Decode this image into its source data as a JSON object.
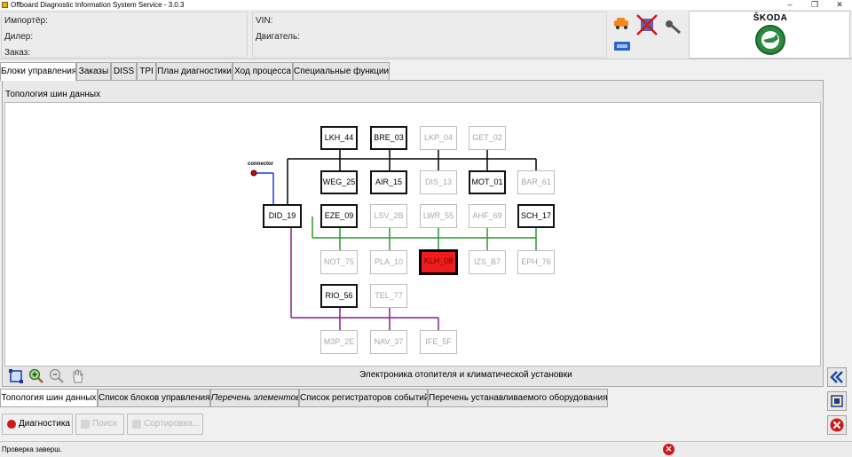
{
  "window": {
    "title": "Offboard Diagnostic Information System Service - 3.0.3",
    "minimize_glyph": "–",
    "restore_glyph": "❐",
    "close_glyph": "✕"
  },
  "header": {
    "importer_label": "Импортёр:",
    "dealer_label": "Дилер:",
    "order_label": "Заказ:",
    "vin_label": "VIN:",
    "engine_label": "Двигатель:",
    "brand": "ŠKODA"
  },
  "main_tabs": [
    {
      "label": "Блоки управления",
      "active": true
    },
    {
      "label": "Заказы"
    },
    {
      "label": "DISS"
    },
    {
      "label": "TPI"
    },
    {
      "label": "План диагностики"
    },
    {
      "label": "Ход процесса"
    },
    {
      "label": "Специальные функции"
    }
  ],
  "topology": {
    "title": "Топология шин данных",
    "connector_label": "connector",
    "description": "Электроника отопителя и климатической установки",
    "nodes": [
      {
        "id": "LKH_44",
        "state": "active"
      },
      {
        "id": "BRE_03",
        "state": "active"
      },
      {
        "id": "LKP_04",
        "state": "inactive"
      },
      {
        "id": "GET_02",
        "state": "inactive"
      },
      {
        "id": "WEG_25",
        "state": "active"
      },
      {
        "id": "AIR_15",
        "state": "active"
      },
      {
        "id": "DIS_13",
        "state": "inactive"
      },
      {
        "id": "MOT_01",
        "state": "active"
      },
      {
        "id": "BAR_61",
        "state": "inactive"
      },
      {
        "id": "DID_19",
        "state": "active"
      },
      {
        "id": "EZE_09",
        "state": "active"
      },
      {
        "id": "LSV_2B",
        "state": "inactive"
      },
      {
        "id": "LWR_55",
        "state": "inactive"
      },
      {
        "id": "AHF_69",
        "state": "inactive"
      },
      {
        "id": "SCH_17",
        "state": "active"
      },
      {
        "id": "NOT_75",
        "state": "inactive"
      },
      {
        "id": "PLA_10",
        "state": "inactive"
      },
      {
        "id": "KLH_08",
        "state": "selected"
      },
      {
        "id": "IZS_B7",
        "state": "inactive"
      },
      {
        "id": "EPH_76",
        "state": "inactive"
      },
      {
        "id": "RIO_56",
        "state": "active"
      },
      {
        "id": "TEL_77",
        "state": "inactive"
      },
      {
        "id": "M3P_2E",
        "state": "inactive"
      },
      {
        "id": "NAV_37",
        "state": "inactive"
      },
      {
        "id": "IFE_5F",
        "state": "inactive"
      }
    ],
    "bus_colors": {
      "diag": "#1e3fd0",
      "comfort": "#000000",
      "drive": "#2a9a2a",
      "infotainment": "#8a1e8a",
      "connector_dot": "#b01010"
    }
  },
  "toolbar_icons": [
    "fit-view-icon",
    "zoom-in-icon",
    "zoom-out-icon",
    "pan-hand-icon"
  ],
  "sub_tabs": [
    {
      "label": "Топология шин данных",
      "active": true
    },
    {
      "label": "Список блоков управления"
    },
    {
      "label": "Перечень элементов",
      "italic": true
    },
    {
      "label": "Список регистраторов событий"
    },
    {
      "label": "Перечень устанавливаемого оборудования"
    }
  ],
  "buttons": {
    "diagnostics": "Диагностика",
    "search": "Поиск",
    "sort": "Сортировка..."
  },
  "status": {
    "text": "Проверка заверш.",
    "error_glyph": "✕"
  }
}
